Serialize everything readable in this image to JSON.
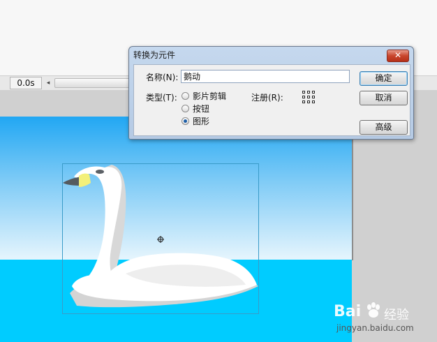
{
  "timeline": {
    "time": "0.0s",
    "scroll_left_glyph": "◂"
  },
  "dialog": {
    "title": "转换为元件",
    "close_glyph": "✕",
    "name_label": "名称(N):",
    "name_value": "鹅动",
    "type_label": "类型(T):",
    "type_options": [
      "影片剪辑",
      "按钮",
      "图形"
    ],
    "selected_type": "图形",
    "registration_label": "注册(R):",
    "buttons": {
      "ok": "确定",
      "cancel": "取消",
      "advanced": "高级"
    }
  },
  "watermark": {
    "brand_a": "Bai",
    "brand_b": "经验",
    "url": "jingyan.baidu.com"
  },
  "colors": {
    "sky_top": "#21a7f3",
    "water": "#00ccff",
    "selection": "#3a9bc8"
  }
}
